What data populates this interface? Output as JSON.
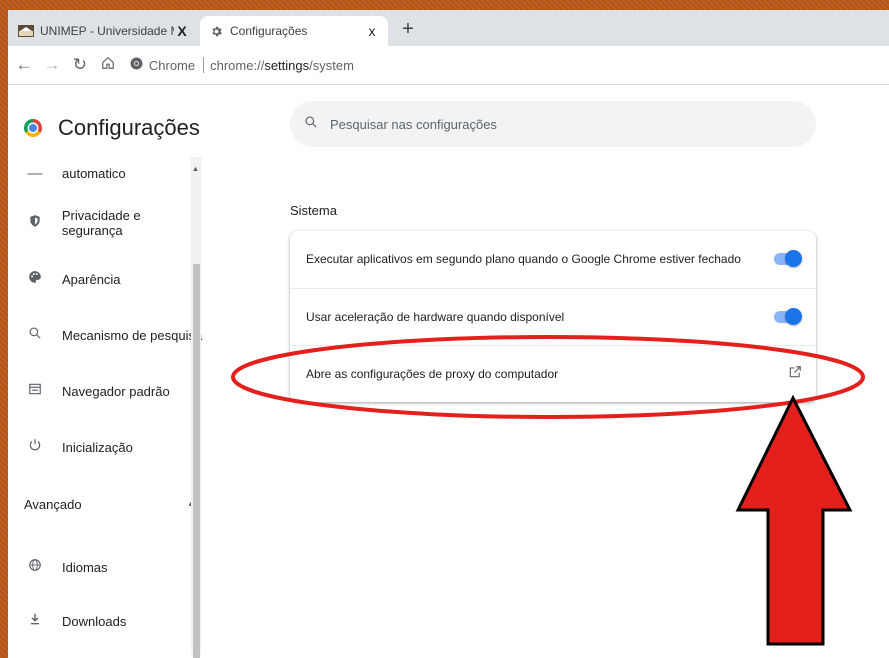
{
  "tabs": [
    {
      "title": "UNIMEP - Universidade Metodist",
      "close": "X",
      "favicon": "unimep-logo-icon"
    },
    {
      "title": "Configurações",
      "close": "x",
      "favicon": "gear-icon"
    }
  ],
  "new_tab": "+",
  "toolbar": {
    "chip_label": "Chrome",
    "url_prefix": "chrome://",
    "url_host": "settings",
    "url_path": "/system"
  },
  "app": {
    "title": "Configurações"
  },
  "search": {
    "placeholder": "Pesquisar nas configurações"
  },
  "sidebar": {
    "partial_item": "automatico",
    "items": [
      {
        "label": "Privacidade e segurança",
        "icon": "shield-icon"
      },
      {
        "label": "Aparência",
        "icon": "palette-icon"
      },
      {
        "label": "Mecanismo de pesquisa",
        "icon": "search-icon"
      },
      {
        "label": "Navegador padrão",
        "icon": "browser-icon"
      },
      {
        "label": "Inicialização",
        "icon": "power-icon"
      }
    ],
    "advanced_label": "Avançado",
    "advanced_items": [
      {
        "label": "Idiomas",
        "icon": "globe-icon"
      },
      {
        "label": "Downloads",
        "icon": "download-icon"
      }
    ]
  },
  "main": {
    "section_title": "Sistema",
    "settings": [
      {
        "label": "Executar aplicativos em segundo plano quando o Google Chrome estiver fechado",
        "enabled": true
      },
      {
        "label": "Usar aceleração de hardware quando disponível",
        "enabled": true
      },
      {
        "label": "Abre as configurações de proxy do computador",
        "action": "external-link-icon"
      }
    ]
  },
  "colors": {
    "accent": "#1a73e8",
    "annotation": "#e3201b",
    "frame": "#b3561c"
  }
}
